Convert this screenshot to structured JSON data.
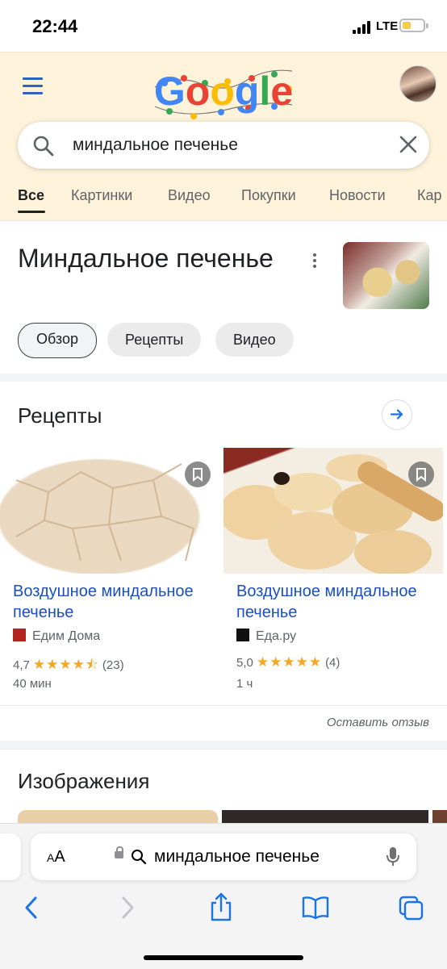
{
  "status_bar": {
    "time": "22:44",
    "network": "LTE"
  },
  "header": {
    "logo_text": "Google",
    "search": {
      "query": "миндальное печенье"
    },
    "tabs": [
      {
        "label": "Все",
        "active": true
      },
      {
        "label": "Картинки"
      },
      {
        "label": "Видео"
      },
      {
        "label": "Покупки"
      },
      {
        "label": "Новости"
      },
      {
        "label": "Кар"
      }
    ]
  },
  "knowledge_panel": {
    "title": "Миндальное печенье",
    "chips": [
      "Обзор",
      "Рецепты",
      "Видео"
    ]
  },
  "recipes": {
    "heading": "Рецепты",
    "cards": [
      {
        "title": "Воздушное миндальное печенье",
        "source": "Едим Дома",
        "rating": "4,7",
        "stars": "★★★★⯪",
        "reviews": "(23)",
        "duration": "40 мин"
      },
      {
        "title": "Воздушное миндальное печенье",
        "source": "Еда.ру",
        "rating": "5,0",
        "stars": "★★★★★",
        "reviews": "(4)",
        "duration": "1 ч"
      }
    ],
    "feedback": "Оставить отзыв"
  },
  "images_section": {
    "heading": "Изображения"
  },
  "browser": {
    "aa_label": "AA",
    "url_text": "миндальное печенье"
  },
  "colors": {
    "link": "#1a4fc4",
    "header_bg": "#fdf2da",
    "star": "#f5a623"
  }
}
